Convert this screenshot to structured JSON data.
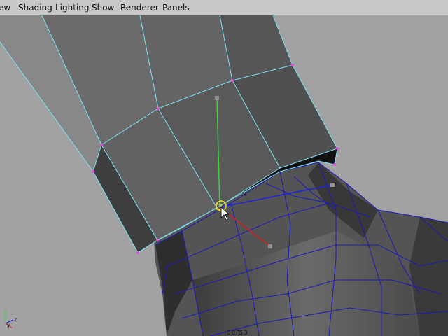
{
  "menubar": {
    "items": [
      {
        "label": "ew"
      },
      {
        "label": "Shading"
      },
      {
        "label": "Lighting"
      },
      {
        "label": "Show"
      },
      {
        "label": "Renderer"
      },
      {
        "label": "Panels"
      }
    ]
  },
  "viewport": {
    "camera_label": "persp",
    "axis_labels": {
      "z": "z",
      "y": "y"
    },
    "colors": {
      "background": "#a2a2a2",
      "wire_selected": "#7ee0f0",
      "wire_mesh": "#1a1ab8",
      "vertex": "#e050e0",
      "manipulator_y": "#40d040",
      "manipulator_x": "#d02020",
      "manipulator_z": "#2020e0",
      "pivot": "#f0e020"
    }
  }
}
